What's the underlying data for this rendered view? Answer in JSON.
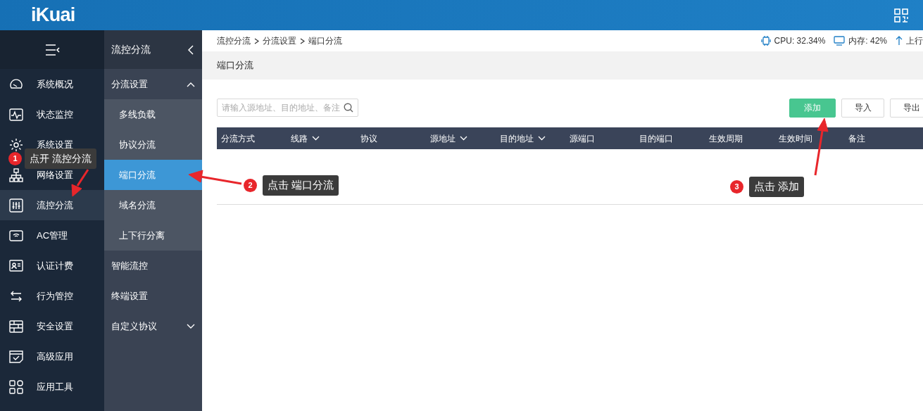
{
  "header": {
    "logo": "iKuai"
  },
  "nav": {
    "items": [
      {
        "label": "系统概况",
        "selected": false
      },
      {
        "label": "状态监控",
        "selected": false
      },
      {
        "label": "系统设置",
        "selected": false
      },
      {
        "label": "网络设置",
        "selected": false
      },
      {
        "label": "流控分流",
        "selected": true
      },
      {
        "label": "AC管理",
        "selected": false
      },
      {
        "label": "认证计费",
        "selected": false
      },
      {
        "label": "行为管控",
        "selected": false
      },
      {
        "label": "安全设置",
        "selected": false
      },
      {
        "label": "高级应用",
        "selected": false
      },
      {
        "label": "应用工具",
        "selected": false
      }
    ]
  },
  "submenu": {
    "title": "流控分流",
    "items": [
      {
        "label": "分流设置",
        "expanded": true,
        "children": [
          {
            "label": "多线负载",
            "selected": false
          },
          {
            "label": "协议分流",
            "selected": false
          },
          {
            "label": "端口分流",
            "selected": true
          },
          {
            "label": "域名分流",
            "selected": false
          },
          {
            "label": "上下行分离",
            "selected": false
          }
        ]
      },
      {
        "label": "智能流控"
      },
      {
        "label": "终端设置"
      },
      {
        "label": "自定义协议",
        "expanded": false
      }
    ]
  },
  "breadcrumb": [
    "流控分流",
    "分流设置",
    "端口分流"
  ],
  "status": {
    "cpu": "CPU: 32.34%",
    "memory": "内存: 42%",
    "upload": "上行"
  },
  "page_title": "端口分流",
  "search": {
    "placeholder": "请输入源地址、目的地址、备注"
  },
  "buttons": [
    {
      "label": "添加",
      "kind": "primary"
    },
    {
      "label": "导入",
      "kind": "default"
    },
    {
      "label": "导出",
      "kind": "default"
    }
  ],
  "table": {
    "columns": [
      {
        "label": "分流方式",
        "filter": false
      },
      {
        "label": "线路",
        "filter": true
      },
      {
        "label": "协议",
        "filter": false
      },
      {
        "label": "源地址",
        "filter": true
      },
      {
        "label": "目的地址",
        "filter": true
      },
      {
        "label": "源端口",
        "filter": false
      },
      {
        "label": "目的端口",
        "filter": false
      },
      {
        "label": "生效周期",
        "filter": false
      },
      {
        "label": "生效时间",
        "filter": false
      },
      {
        "label": "备注",
        "filter": false
      }
    ]
  },
  "callouts": [
    {
      "number": "1",
      "text": "点开 流控分流"
    },
    {
      "number": "2",
      "text": "点击 端口分流"
    },
    {
      "number": "3",
      "text": "点击 添加"
    }
  ]
}
